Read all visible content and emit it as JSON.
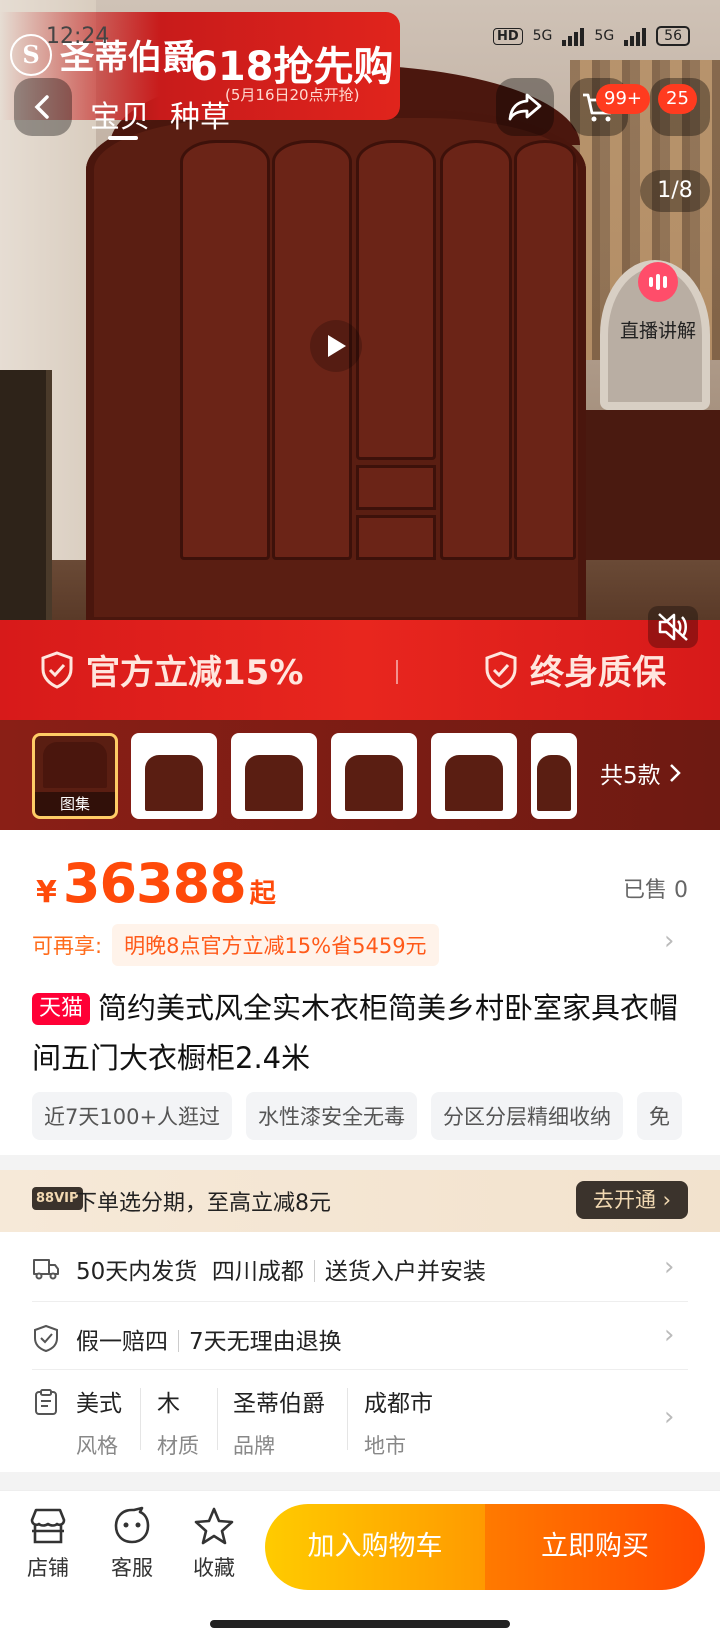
{
  "status": {
    "time": "12:24",
    "hd": "HD",
    "net1": "5G",
    "net2": "5G",
    "battery": "56"
  },
  "banner": {
    "brand": "圣蒂伯爵",
    "brand_initial": "S",
    "promo": "618抢先购",
    "promo_date": "(5月16日20点开抢)"
  },
  "nav": {
    "tabs": [
      "宝贝",
      "种草"
    ],
    "cart_badge": "99+",
    "msg_badge": "25"
  },
  "gallery": {
    "counter": "1/8",
    "live_label": "直播讲解",
    "thumb_first_label": "图集",
    "more_label": "共5款"
  },
  "promo_strip": {
    "left": "官方立减15%",
    "right": "终身质保"
  },
  "price": {
    "currency": "¥",
    "value": "36388",
    "suffix": "起",
    "sold": "已售 0"
  },
  "enjoy": {
    "label": "可再享:",
    "text": "明晚8点官方立减15%省5459元"
  },
  "product": {
    "tmall_badge": "天猫",
    "title": "简约美式风全实木衣柜简美乡村卧室家具衣帽间五门大衣橱柜2.4米",
    "tags": [
      "近7天100+人逛过",
      "水性漆安全无毒",
      "分区分层精细收纳",
      "免"
    ]
  },
  "vip": {
    "badge": "88VIP",
    "text": "下单选分期，至高立减8元",
    "button": "去开通"
  },
  "shipping": {
    "a": "50天内发货",
    "b": "四川成都",
    "c": "送货入户并安装"
  },
  "guarantee": {
    "a": "假一赔四",
    "b": "7天无理由退换"
  },
  "specs": [
    {
      "value": "美式",
      "key": "风格"
    },
    {
      "value": "木",
      "key": "材质"
    },
    {
      "value": "圣蒂伯爵",
      "key": "品牌"
    },
    {
      "value": "成都市",
      "key": "地市"
    }
  ],
  "bottom": {
    "shop": "店铺",
    "service": "客服",
    "fav": "收藏",
    "cart_btn": "加入购物车",
    "buy_btn": "立即购买"
  },
  "colors": {
    "accent": "#ff4a0a",
    "tmall": "#ff0036",
    "promo_red": "#e0241c"
  }
}
